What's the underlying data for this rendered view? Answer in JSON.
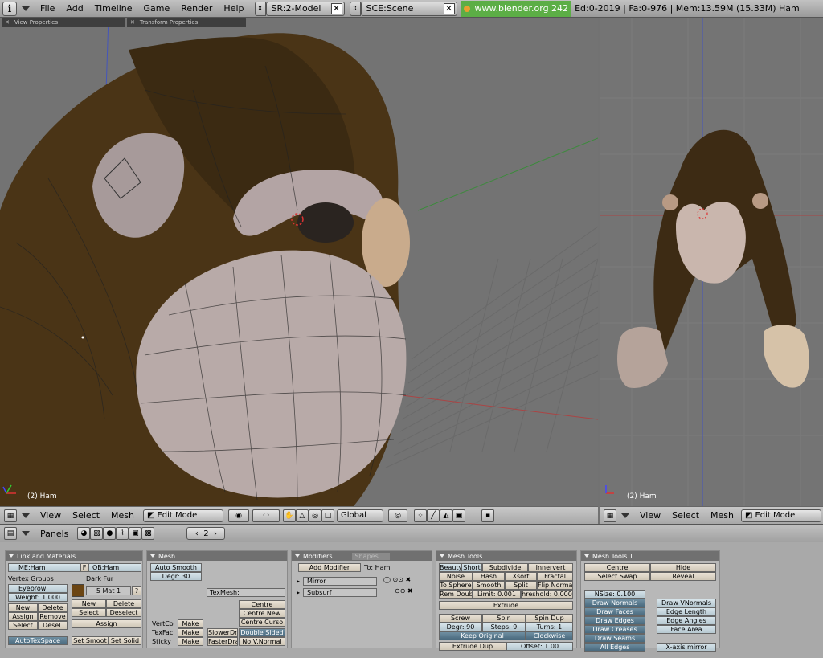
{
  "topbar": {
    "menus": [
      "File",
      "Add",
      "Timeline",
      "Game",
      "Render",
      "Help"
    ],
    "screen": "SR:2-Model",
    "scene": "SCE:Scene",
    "url": "www.blender.org 242",
    "stats": "Ed:0-2019 | Fa:0-976 | Mem:13.59M (15.33M) Ham"
  },
  "viewport_left": {
    "panels": [
      "View Properties",
      "Transform Properties"
    ],
    "object_label": "(2) Ham"
  },
  "viewport_right": {
    "object_label": "(2) Ham"
  },
  "view_header_left": {
    "menus": [
      "View",
      "Select",
      "Mesh"
    ],
    "mode": "Edit Mode",
    "orientation": "Global"
  },
  "view_header_right": {
    "menus": [
      "View",
      "Select",
      "Mesh"
    ],
    "mode": "Edit Mode"
  },
  "buttons_header": {
    "label": "Panels",
    "number": "2"
  },
  "link_materials": {
    "title": "Link and Materials",
    "mesh": "ME:Ham",
    "mesh_flag": "F",
    "object": "OB:Ham",
    "vertex_groups_label": "Vertex Groups",
    "vgroup": "Eyebrow",
    "weight": "Weight: 1.000",
    "material_label": "Dark Fur",
    "mat": "5 Mat 1",
    "help": "?",
    "new": "New",
    "delete": "Delete",
    "assign": "Assign",
    "remove": "Remove",
    "select": "Select",
    "deselect": "Desel.",
    "mat_new": "New",
    "mat_delete": "Delete",
    "mat_select": "Select",
    "mat_deselect": "Deselect",
    "mat_assign": "Assign",
    "autotex": "AutoTexSpace",
    "set_smooth": "Set Smoot",
    "set_solid": "Set Solid"
  },
  "mesh_panel": {
    "title": "Mesh",
    "auto_smooth": "Auto Smooth",
    "degr": "Degr: 30",
    "texmesh": "TexMesh:",
    "centre": "Centre",
    "centre_new": "Centre New",
    "centre_cursor": "Centre Curso",
    "vertcol": "VertCo",
    "texface": "TexFac",
    "sticky": "Sticky",
    "make1": "Make",
    "make2": "Make",
    "make3": "Make",
    "slower": "SlowerDr",
    "faster": "FasterDra",
    "double_sided": "Double Sided",
    "no_vnormal": "No V.Normal"
  },
  "modifiers": {
    "tab_modifiers": "Modifiers",
    "tab_shapes": "Shapes",
    "add": "Add Modifier",
    "to": "To: Ham",
    "items": [
      "Mirror",
      "Subsurf"
    ]
  },
  "mesh_tools": {
    "title": "Mesh Tools",
    "beauty": "Beauty",
    "short": "Short",
    "subdivide": "Subdivide",
    "innervert": "Innervert",
    "noise": "Noise",
    "hash": "Hash",
    "xsort": "Xsort",
    "fractal": "Fractal",
    "to_sphere": "To Sphere",
    "smooth": "Smooth",
    "split": "Split",
    "flip_normals": "Flip Norma",
    "rem_doubles": "Rem Doub",
    "limit": "Limit: 0.001",
    "threshold": "hreshold: 0.000",
    "extrude": "Extrude",
    "screw": "Screw",
    "spin": "Spin",
    "spin_dup": "Spin Dup",
    "degr": "Degr: 90",
    "steps": "Steps: 9",
    "turns": "Turns: 1",
    "keep_original": "Keep Original",
    "clockwise": "Clockwise",
    "extrude_dup": "Extrude Dup",
    "offset": "Offset: 1.00"
  },
  "mesh_tools1": {
    "title": "Mesh Tools 1",
    "centre": "Centre",
    "hide": "Hide",
    "select_swap": "Select Swap",
    "reveal": "Reveal",
    "nsize": "NSize: 0.100",
    "draw_normals": "Draw Normals",
    "draw_faces": "Draw Faces",
    "draw_edges": "Draw Edges",
    "draw_creases": "Draw Creases",
    "draw_seams": "Draw Seams",
    "all_edges": "All Edges",
    "draw_vnormals": "Draw VNormals",
    "edge_length": "Edge Length",
    "edge_angles": "Edge Angles",
    "face_area": "Face Area",
    "xmirror": "X-axis mirror"
  }
}
